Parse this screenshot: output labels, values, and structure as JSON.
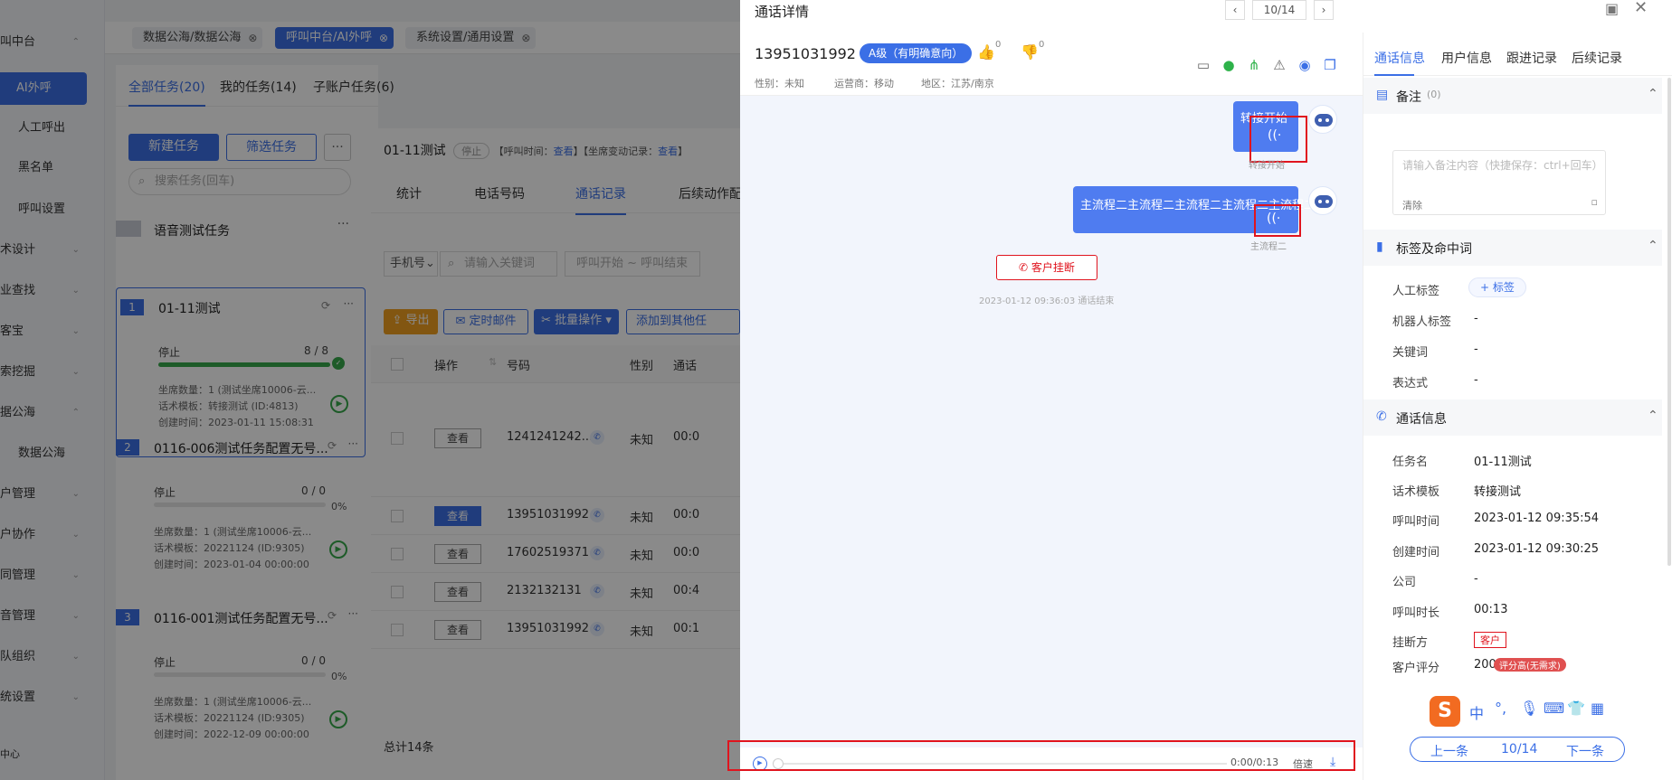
{
  "sidebar": {
    "items": [
      {
        "label": "叫中台",
        "arrow": "^"
      },
      {
        "label": "AI外呼"
      },
      {
        "label": "人工呼出"
      },
      {
        "label": "黑名单"
      },
      {
        "label": "呼叫设置"
      },
      {
        "label": "术设计",
        "arrow": "v"
      },
      {
        "label": "业查找",
        "arrow": "v"
      },
      {
        "label": "客宝",
        "arrow": "v"
      },
      {
        "label": "索挖掘",
        "arrow": "v"
      },
      {
        "label": "据公海",
        "arrow": "^"
      },
      {
        "label": "数据公海"
      },
      {
        "label": "户管理",
        "arrow": "v"
      },
      {
        "label": "户协作",
        "arrow": "v"
      },
      {
        "label": "同管理",
        "arrow": "v"
      },
      {
        "label": "音管理",
        "arrow": "v"
      },
      {
        "label": "队组织",
        "arrow": "v"
      },
      {
        "label": "统设置",
        "arrow": "v"
      },
      {
        "label": "中心"
      }
    ]
  },
  "breadcrumbs": [
    {
      "label": "数据公海/数据公海"
    },
    {
      "label": "呼叫中台/AI外呼"
    },
    {
      "label": "系统设置/通用设置"
    }
  ],
  "tasklist": {
    "tabs": [
      "全部任务(20)",
      "我的任务(14)",
      "子账户任务(6)"
    ],
    "new_task": "新建任务",
    "filter_task": "筛选任务",
    "more": "···",
    "search_placeholder": "搜索任务(回车)",
    "group_label": "语音测试任务",
    "tasks": [
      {
        "num": "1",
        "name": "01-11测试",
        "status": "停止",
        "count": "8 / 8",
        "progress": 1.0,
        "pct": "",
        "seats": "坐席数量：1 (测试坐席10006-云...",
        "template": "话术模板：转接测试 (ID:4813)",
        "created": "创建时间：2023-01-11 15:08:31"
      },
      {
        "num": "2",
        "name": "0116-006测试任务配置无号...",
        "status": "停止",
        "count": "0 / 0",
        "progress": 0.0,
        "pct": "0%",
        "seats": "坐席数量：1 (测试坐席10006-云...",
        "template": "话术模板：20221124 (ID:9305)",
        "created": "创建时间：2023-01-04 00:00:00"
      },
      {
        "num": "3",
        "name": "0116-001测试任务配置无号...",
        "status": "停止",
        "count": "0 / 0",
        "progress": 0.0,
        "pct": "0%",
        "seats": "坐席数量：1 (测试坐席10006-云...",
        "template": "话术模板：20221124 (ID:9305)",
        "created": "创建时间：2022-12-09 00:00:00"
      }
    ]
  },
  "main": {
    "task_title": "01-11测试",
    "status_tag": "停止",
    "header_info": "【呼叫时间：",
    "header_link1": "查看",
    "header_info2": "】【坐席变动记录：",
    "header_link2": "查看",
    "header_info3": "】",
    "tabs": [
      "统计",
      "电话号码",
      "通话记录",
      "后续动作配"
    ],
    "filter_phone": "手机号",
    "filter_keyword": "请输入关键词",
    "filter_time": "呼叫开始 ~ 呼叫结束",
    "export": "导出",
    "timed_mail": "定时邮件",
    "batch": "批量操作",
    "add_other": "添加到其他任",
    "columns": [
      "操作",
      "号码",
      "性别",
      "通话"
    ],
    "rows": [
      {
        "action": "查看",
        "phone": "1241241242...",
        "gender": "未知",
        "dur": "00:0"
      },
      {
        "action": "查看",
        "phone": "13951031992",
        "gender": "未知",
        "dur": "00:0"
      },
      {
        "action": "查看",
        "phone": "17602519371",
        "gender": "未知",
        "dur": "00:0"
      },
      {
        "action": "查看",
        "phone": "2132132131",
        "gender": "未知",
        "dur": "00:4"
      },
      {
        "action": "查看",
        "phone": "13951031992",
        "gender": "未知",
        "dur": "00:1"
      }
    ],
    "total": "总计14条"
  },
  "drawer": {
    "title": "通话详情",
    "pager": "10/14",
    "phone": "13951031992",
    "level": "A级（有明确意向）",
    "likes": "0",
    "dislikes": "0",
    "gender": "性别：未知",
    "carrier": "运营商：移动",
    "region": "地区：江苏/南京",
    "msg1": "转接开始",
    "msg1_caption": "转接开始",
    "msg2": "主流程二主流程二主流程二主流程二主流程二",
    "msg2_caption": "主流程二",
    "hangup": "客户挂断",
    "end_note": "2023-01-12 09:36:03 通话结束",
    "player_time": "0:00/0:13",
    "speed": "倍速",
    "side_tabs": [
      "通话信息",
      "用户信息",
      "跟进记录",
      "后续记录"
    ],
    "remark": {
      "title": "备注",
      "count": "(0)",
      "placeholder": "请输入备注内容（快捷保存：ctrl+回车）",
      "clear": "清除"
    },
    "tags_section": "标签及命中词",
    "tags": [
      {
        "k": "人工标签",
        "v": "+ 标签"
      },
      {
        "k": "机器人标签",
        "v": "-"
      },
      {
        "k": "关键词",
        "v": "-"
      },
      {
        "k": "表达式",
        "v": "-"
      }
    ],
    "call_section": "通话信息",
    "call_info": [
      {
        "k": "任务名",
        "v": "01-11测试"
      },
      {
        "k": "话术模板",
        "v": "转接测试"
      },
      {
        "k": "呼叫时间",
        "v": "2023-01-12 09:35:54"
      },
      {
        "k": "创建时间",
        "v": "2023-01-12 09:30:25"
      },
      {
        "k": "公司",
        "v": "-"
      },
      {
        "k": "呼叫时长",
        "v": "00:13"
      },
      {
        "k": "挂断方",
        "v": "客户"
      },
      {
        "k": "客户评分",
        "v": "200"
      }
    ],
    "score_badge": "评分高(无需求)",
    "nav": {
      "prev": "上一条",
      "page": "10/14",
      "next": "下一条"
    },
    "ime": {
      "logo": "S",
      "lang": "中"
    }
  },
  "colors": {
    "primary": "#3b6fe6",
    "highlight": "#e0141e",
    "green": "#37a84b",
    "warn": "#f0a020"
  }
}
